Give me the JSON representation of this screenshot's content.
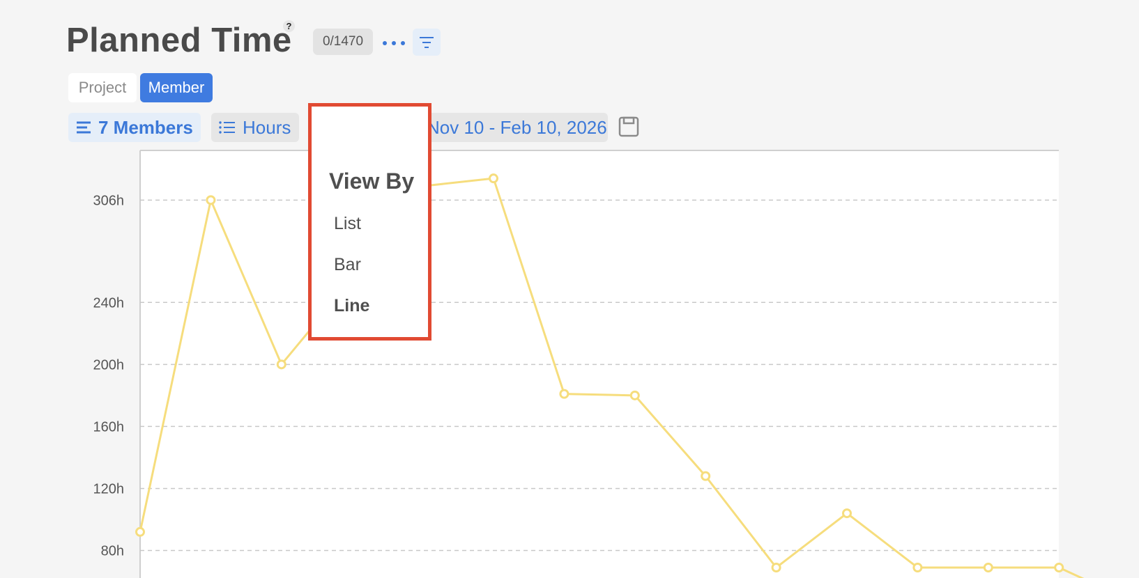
{
  "header": {
    "title": "Planned Time",
    "help": "?",
    "count_badge": "0/1470"
  },
  "view_toggle": {
    "project": "Project",
    "member": "Member",
    "selected": "Member"
  },
  "toolbar": {
    "members": "7 Members",
    "hours": "Hours",
    "chart_type": "Line",
    "date_range": "Nov 10 - Feb 10, 2026"
  },
  "icons": [
    "help-icon",
    "more-icon",
    "filter-icon",
    "list-lines-icon",
    "list-bullets-icon",
    "line-chart-icon",
    "calendar-icon",
    "save-icon"
  ],
  "view_menu": {
    "title": "View By",
    "items": [
      "List",
      "Bar",
      "Line"
    ],
    "selected": "Line"
  },
  "colors": {
    "accent": "#3f7be0",
    "series": "#f6dd7d",
    "highlight": "#e14a32"
  },
  "chart_data": {
    "type": "line",
    "ylabel": "",
    "xlabel": "",
    "ytick_labels": [
      "306h",
      "240h",
      "200h",
      "160h",
      "120h",
      "80h"
    ],
    "ytick_values": [
      306,
      240,
      200,
      160,
      120,
      80
    ],
    "grid": true,
    "series": [
      {
        "values": [
          92,
          306,
          200,
          255,
          315,
          320,
          181,
          180,
          128,
          69,
          104,
          69,
          69,
          69,
          48
        ]
      }
    ]
  }
}
